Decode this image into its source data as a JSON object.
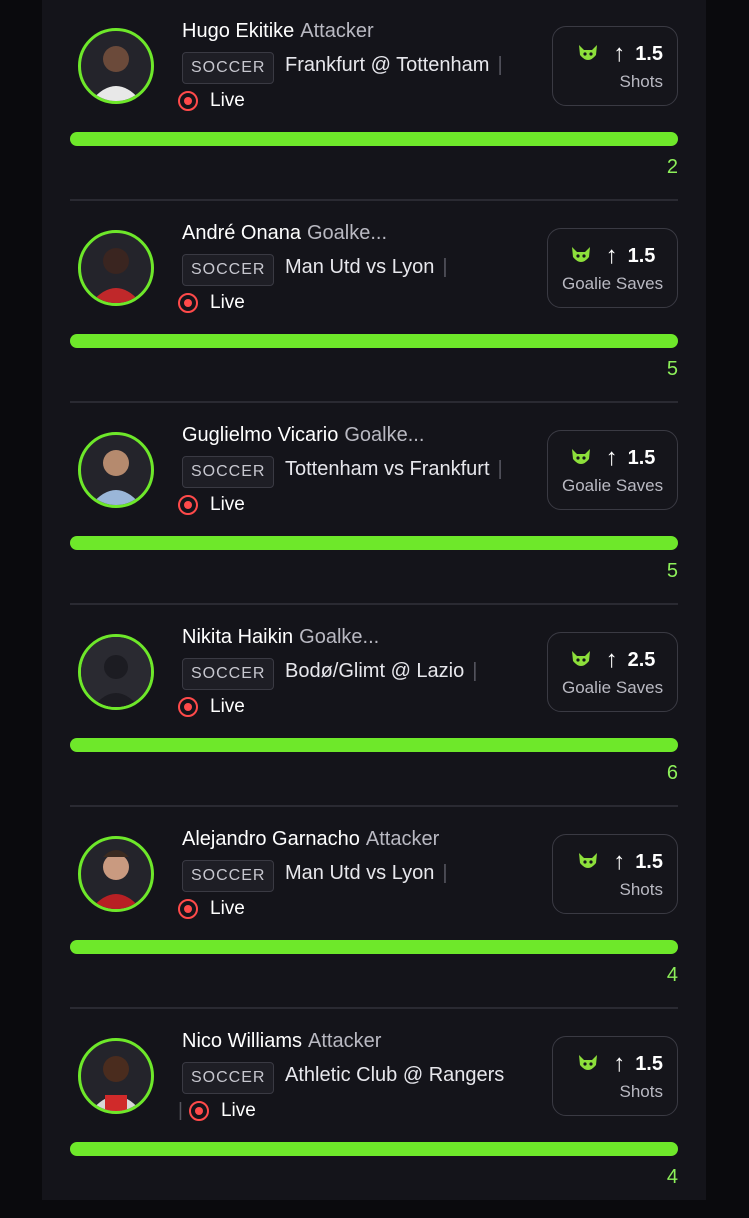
{
  "colors": {
    "accent": "#6ee82a",
    "live": "#ff4a4a",
    "background": "#14141a"
  },
  "cards": [
    {
      "name": "Hugo Ekitike",
      "position": "Attacker",
      "sport": "SOCCER",
      "match": "Frankfurt @ Tottenham",
      "live": "Live",
      "line": "1.5",
      "stat": "Shots",
      "result": "2",
      "progress": 1.0,
      "avatar": "player-photo"
    },
    {
      "name": "André Onana",
      "position": "Goalke...",
      "sport": "SOCCER",
      "match": "Man Utd vs Lyon",
      "live": "Live",
      "line": "1.5",
      "stat": "Goalie Saves",
      "result": "5",
      "progress": 1.0,
      "avatar": "player-photo"
    },
    {
      "name": "Guglielmo Vicario",
      "position": "Goalke...",
      "sport": "SOCCER",
      "match": "Tottenham vs Frankfurt",
      "live": "Live",
      "line": "1.5",
      "stat": "Goalie Saves",
      "result": "5",
      "progress": 1.0,
      "avatar": "player-photo"
    },
    {
      "name": "Nikita Haikin",
      "position": "Goalke...",
      "sport": "SOCCER",
      "match": "Bodø/Glimt @ Lazio",
      "live": "Live",
      "line": "2.5",
      "stat": "Goalie Saves",
      "result": "6",
      "progress": 1.0,
      "avatar": "placeholder-silhouette"
    },
    {
      "name": "Alejandro Garnacho",
      "position": "Attacker",
      "sport": "SOCCER",
      "match": "Man Utd vs Lyon",
      "live": "Live",
      "line": "1.5",
      "stat": "Shots",
      "result": "4",
      "progress": 1.0,
      "avatar": "player-photo"
    },
    {
      "name": "Nico Williams",
      "position": "Attacker",
      "sport": "SOCCER",
      "match": "Athletic Club @ Rangers",
      "live": "Live",
      "line": "1.5",
      "stat": "Shots",
      "result": "4",
      "progress": 1.0,
      "avatar": "player-photo"
    }
  ]
}
